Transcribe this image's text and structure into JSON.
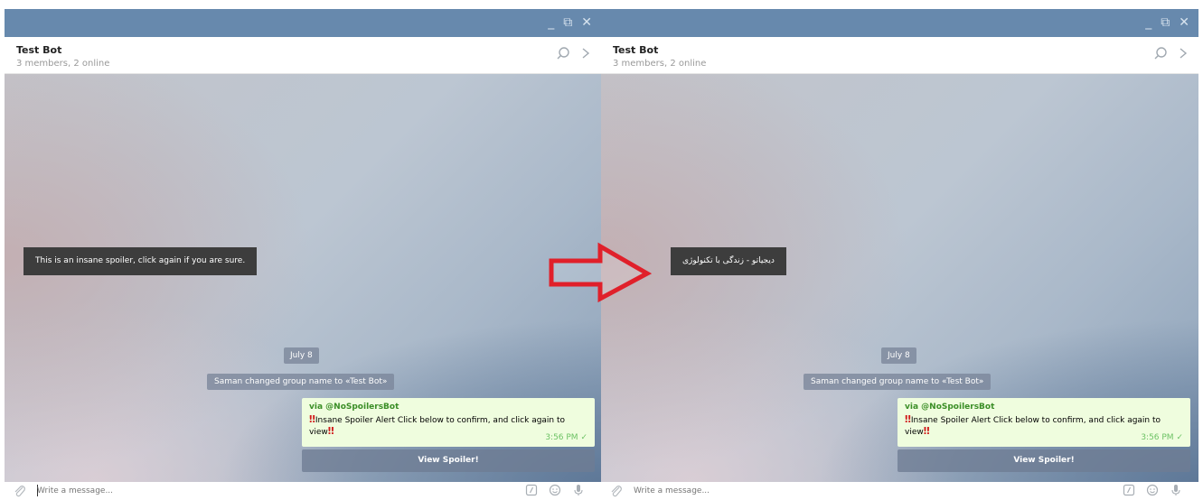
{
  "window": {
    "minimize_glyph": "_",
    "restore_glyph": "⧉",
    "close_glyph": "✕"
  },
  "panels": [
    {
      "header": {
        "title": "Test Bot",
        "subtitle": "3 members, 2 online"
      },
      "tooltip": "This is an insane spoiler, click again if you are sure.",
      "date": "July 8",
      "service_message": "Saman changed group name to «Test Bot»",
      "message": {
        "via": "via @NoSpoilersBot",
        "bang": "‼",
        "text": "Insane Spoiler Alert Click below to confirm, and click again to view",
        "time": "3:56 PM"
      },
      "button": "View Spoiler!",
      "compose_placeholder": "Write a message..."
    },
    {
      "header": {
        "title": "Test Bot",
        "subtitle": "3 members, 2 online"
      },
      "tooltip": "دیجیاتو - زندگی با تکنولوژی",
      "date": "July 8",
      "service_message": "Saman changed group name to «Test Bot»",
      "message": {
        "via": "via @NoSpoilersBot",
        "bang": "‼",
        "text": "Insane Spoiler Alert Click below to confirm, and click again to view",
        "time": "3:56 PM"
      },
      "button": "View Spoiler!",
      "compose_placeholder": "Write a message..."
    }
  ],
  "colors": {
    "titlebar": "#6789ad",
    "message_bubble": "#effdde",
    "via_link": "#3a8e26",
    "alert": "#d01d1d",
    "arrow": "#e0202a"
  },
  "icons": [
    "search-icon",
    "chevron-right-icon",
    "paperclip-icon",
    "bot-command-icon",
    "emoji-icon",
    "microphone-icon",
    "red-arrow-icon"
  ]
}
